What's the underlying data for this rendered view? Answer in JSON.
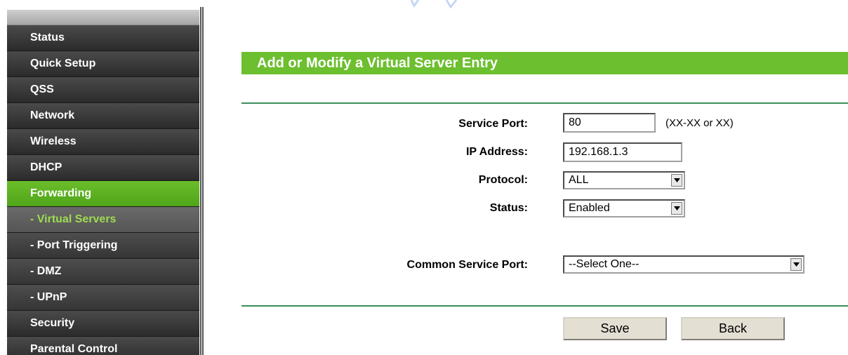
{
  "sidebar": {
    "items": [
      {
        "label": "Status",
        "kind": "main",
        "active": false
      },
      {
        "label": "Quick Setup",
        "kind": "main",
        "active": false
      },
      {
        "label": "QSS",
        "kind": "main",
        "active": false
      },
      {
        "label": "Network",
        "kind": "main",
        "active": false
      },
      {
        "label": "Wireless",
        "kind": "main",
        "active": false
      },
      {
        "label": "DHCP",
        "kind": "main",
        "active": false
      },
      {
        "label": "Forwarding",
        "kind": "main",
        "active": true
      },
      {
        "label": "- Virtual Servers",
        "kind": "sub",
        "active": true
      },
      {
        "label": "- Port Triggering",
        "kind": "sub",
        "active": false
      },
      {
        "label": "- DMZ",
        "kind": "sub",
        "active": false
      },
      {
        "label": "- UPnP",
        "kind": "sub",
        "active": false
      },
      {
        "label": "Security",
        "kind": "main",
        "active": false
      },
      {
        "label": "Parental Control",
        "kind": "main",
        "active": false
      }
    ]
  },
  "main": {
    "title": "Add or Modify a Virtual Server Entry",
    "form": {
      "service_port": {
        "label": "Service Port:",
        "value": "80",
        "hint": "(XX-XX or XX)"
      },
      "ip_address": {
        "label": "IP Address:",
        "value": "192.168.1.3"
      },
      "protocol": {
        "label": "Protocol:",
        "selected": "ALL"
      },
      "status": {
        "label": "Status:",
        "selected": "Enabled"
      },
      "common_service_port": {
        "label": "Common Service Port:",
        "selected": "--Select One--"
      }
    },
    "buttons": {
      "save": "Save",
      "back": "Back"
    }
  },
  "colors": {
    "accent_green": "#6cbf2e",
    "nav_dark": "#2b2b2b",
    "sub_active_text": "#9ddc4f",
    "rule_green": "#3a8f5a",
    "button_face": "#e3dfd3"
  }
}
